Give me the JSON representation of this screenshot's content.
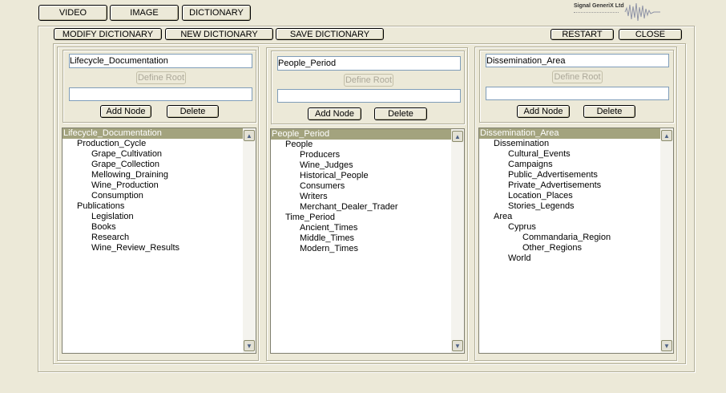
{
  "top_tabs": [
    "VIDEO",
    "IMAGE",
    "DICTIONARY"
  ],
  "logo": {
    "text": "Signal GeneriX Ltd"
  },
  "toolbar": {
    "modify": "MODIFY DICTIONARY",
    "new": "NEW DICTIONARY",
    "save": "SAVE DICTIONARY",
    "restart": "RESTART",
    "close": "CLOSE"
  },
  "panels": [
    {
      "name_value": "Lifecycle_Documentation",
      "define_root": "Define Root",
      "node_value": "",
      "add_node": "Add Node",
      "delete": "Delete",
      "tree_root": "Lifecycle_Documentation",
      "nodes": [
        {
          "label": "Production_Cycle",
          "depth": 1
        },
        {
          "label": "Grape_Cultivation",
          "depth": 2
        },
        {
          "label": "Grape_Collection",
          "depth": 2
        },
        {
          "label": "Mellowing_Draining",
          "depth": 2
        },
        {
          "label": "Wine_Production",
          "depth": 2
        },
        {
          "label": "Consumption",
          "depth": 2
        },
        {
          "label": "Publications",
          "depth": 1
        },
        {
          "label": "Legislation",
          "depth": 2
        },
        {
          "label": "Books",
          "depth": 2
        },
        {
          "label": "Research",
          "depth": 2
        },
        {
          "label": "Wine_Review_Results",
          "depth": 2
        }
      ]
    },
    {
      "name_value": "People_Period",
      "define_root": "Define Root",
      "node_value": "",
      "add_node": "Add Node",
      "delete": "Delete",
      "tree_root": "People_Period",
      "nodes": [
        {
          "label": "People",
          "depth": 1
        },
        {
          "label": "Producers",
          "depth": 2
        },
        {
          "label": "Wine_Judges",
          "depth": 2
        },
        {
          "label": "Historical_People",
          "depth": 2
        },
        {
          "label": "Consumers",
          "depth": 2
        },
        {
          "label": "Writers",
          "depth": 2
        },
        {
          "label": "Merchant_Dealer_Trader",
          "depth": 2
        },
        {
          "label": "Time_Period",
          "depth": 1
        },
        {
          "label": "Ancient_Times",
          "depth": 2
        },
        {
          "label": "Middle_Times",
          "depth": 2
        },
        {
          "label": "Modern_Times",
          "depth": 2
        }
      ]
    },
    {
      "name_value": "Dissemination_Area",
      "define_root": "Define Root",
      "node_value": "",
      "add_node": "Add Node",
      "delete": "Delete",
      "tree_root": "Dissemination_Area",
      "nodes": [
        {
          "label": "Dissemination",
          "depth": 1
        },
        {
          "label": "Cultural_Events",
          "depth": 2
        },
        {
          "label": "Campaigns",
          "depth": 2
        },
        {
          "label": "Public_Advertisements",
          "depth": 2
        },
        {
          "label": "Private_Advertisements",
          "depth": 2
        },
        {
          "label": "Location_Places",
          "depth": 2
        },
        {
          "label": "Stories_Legends",
          "depth": 2
        },
        {
          "label": "Area",
          "depth": 1
        },
        {
          "label": "Cyprus",
          "depth": 2
        },
        {
          "label": "Commandaria_Region",
          "depth": 3
        },
        {
          "label": "Other_Regions",
          "depth": 3
        },
        {
          "label": "World",
          "depth": 2
        }
      ]
    }
  ],
  "icons": {
    "scroll_up": "scroll-up-arrow-icon",
    "scroll_down": "scroll-down-arrow-icon"
  },
  "colors": {
    "background": "#ece9d8",
    "selection": "#a3a37e",
    "border": "#b1ae98"
  }
}
